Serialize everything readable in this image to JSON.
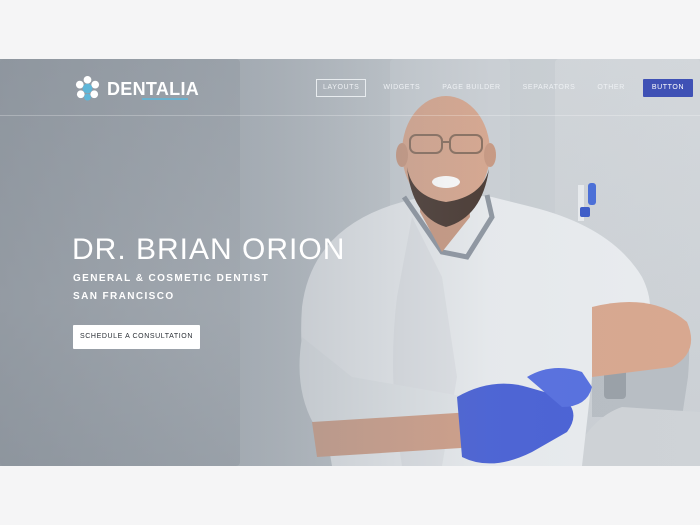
{
  "brand": {
    "name": "DENTALIA"
  },
  "nav": {
    "items": [
      "LAYOUTS",
      "WIDGETS",
      "PAGE BUILDER",
      "SEPARATORS",
      "OTHER"
    ],
    "button": "BUTTON"
  },
  "hero": {
    "title": "DR. BRIAN ORION",
    "subtitle_1": "GENERAL & COSMETIC DENTIST",
    "subtitle_2": "SAN FRANCISCO",
    "cta": "SCHEDULE A CONSULTATION"
  },
  "colors": {
    "accent": "#3f51b5",
    "logo_blue": "#5fb6d8",
    "glove": "#4a62d6"
  },
  "icons": [
    "logo-flower-icon"
  ]
}
